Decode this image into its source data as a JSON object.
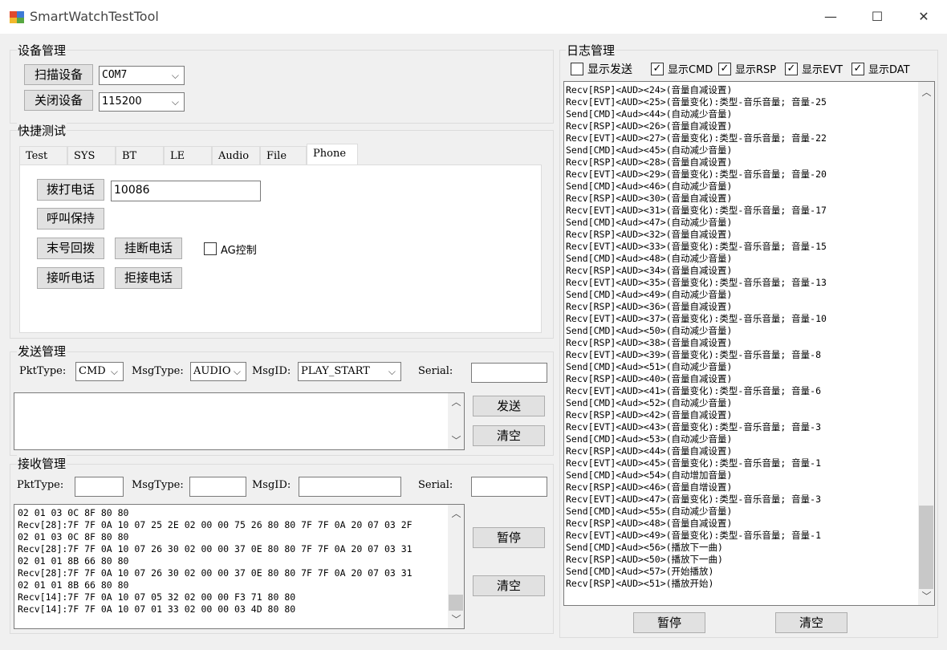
{
  "window": {
    "title": "SmartWatchTestTool",
    "minimize": "—",
    "maximize": "☐",
    "close": "✕"
  },
  "device": {
    "group_label": "设备管理",
    "scan_button": "扫描设备",
    "close_button": "关闭设备",
    "port": "COM7",
    "baud": "115200"
  },
  "quick": {
    "group_label": "快捷测试",
    "tabs": [
      "Test",
      "SYS",
      "BT",
      "LE",
      "Audio",
      "File",
      "Phone"
    ],
    "active_tab": "Phone",
    "dial_button": "拨打电话",
    "dial_number": "10086",
    "hold_button": "呼叫保持",
    "redial_button": "末号回拨",
    "hangup_button": "挂断电话",
    "ag_control_label": "AG控制",
    "answer_button": "接听电话",
    "reject_button": "拒接电话"
  },
  "send": {
    "group_label": "发送管理",
    "pkttype_label": "PktType:",
    "pkttype_value": "CMD",
    "msgtype_label": "MsgType:",
    "msgtype_value": "AUDIO",
    "msgid_label": "MsgID:",
    "msgid_value": "PLAY_START",
    "serial_label": "Serial:",
    "serial_value": "",
    "send_button": "发送",
    "clear_button": "清空"
  },
  "recv": {
    "group_label": "接收管理",
    "pkttype_label": "PktType:",
    "msgtype_label": "MsgType:",
    "msgid_label": "MsgID:",
    "serial_label": "Serial:",
    "pause_button": "暂停",
    "clear_button": "清空",
    "lines": [
      "02 01 03 0C 8F 80 80",
      "Recv[28]:7F 7F 0A 10 07 25 2E 02 00 00 75 26 80 80 7F 7F 0A 20 07 03 2F",
      "02 01 03 0C 8F 80 80",
      "Recv[28]:7F 7F 0A 10 07 26 30 02 00 00 37 0E 80 80 7F 7F 0A 20 07 03 31",
      "02 01 01 8B 66 80 80",
      "Recv[28]:7F 7F 0A 10 07 26 30 02 00 00 37 0E 80 80 7F 7F 0A 20 07 03 31",
      "02 01 01 8B 66 80 80",
      "Recv[14]:7F 7F 0A 10 07 05 32 02 00 00 F3 71 80 80",
      "Recv[14]:7F 7F 0A 10 07 01 33 02 00 00 03 4D 80 80"
    ]
  },
  "log": {
    "group_label": "日志管理",
    "filters": [
      {
        "label": "显示发送",
        "checked": false
      },
      {
        "label": "显示CMD",
        "checked": true
      },
      {
        "label": "显示RSP",
        "checked": true
      },
      {
        "label": "显示EVT",
        "checked": true
      },
      {
        "label": "显示DAT",
        "checked": true
      }
    ],
    "lines": [
      "Recv[RSP]<AUD><24>(音量自减设置)",
      "Recv[EVT]<AUD><25>(音量变化):类型-音乐音量; 音量-25",
      "Send[CMD]<Aud><44>(自动减少音量)",
      "Recv[RSP]<AUD><26>(音量自减设置)",
      "Recv[EVT]<AUD><27>(音量变化):类型-音乐音量; 音量-22",
      "Send[CMD]<Aud><45>(自动减少音量)",
      "Recv[RSP]<AUD><28>(音量自减设置)",
      "Recv[EVT]<AUD><29>(音量变化):类型-音乐音量; 音量-20",
      "Send[CMD]<Aud><46>(自动减少音量)",
      "Recv[RSP]<AUD><30>(音量自减设置)",
      "Recv[EVT]<AUD><31>(音量变化):类型-音乐音量; 音量-17",
      "Send[CMD]<Aud><47>(自动减少音量)",
      "Recv[RSP]<AUD><32>(音量自减设置)",
      "Recv[EVT]<AUD><33>(音量变化):类型-音乐音量; 音量-15",
      "Send[CMD]<Aud><48>(自动减少音量)",
      "Recv[RSP]<AUD><34>(音量自减设置)",
      "Recv[EVT]<AUD><35>(音量变化):类型-音乐音量; 音量-13",
      "Send[CMD]<Aud><49>(自动减少音量)",
      "Recv[RSP]<AUD><36>(音量自减设置)",
      "Recv[EVT]<AUD><37>(音量变化):类型-音乐音量; 音量-10",
      "Send[CMD]<Aud><50>(自动减少音量)",
      "Recv[RSP]<AUD><38>(音量自减设置)",
      "Recv[EVT]<AUD><39>(音量变化):类型-音乐音量; 音量-8",
      "Send[CMD]<Aud><51>(自动减少音量)",
      "Recv[RSP]<AUD><40>(音量自减设置)",
      "Recv[EVT]<AUD><41>(音量变化):类型-音乐音量; 音量-6",
      "Send[CMD]<Aud><52>(自动减少音量)",
      "Recv[RSP]<AUD><42>(音量自减设置)",
      "Recv[EVT]<AUD><43>(音量变化):类型-音乐音量; 音量-3",
      "Send[CMD]<Aud><53>(自动减少音量)",
      "Recv[RSP]<AUD><44>(音量自减设置)",
      "Recv[EVT]<AUD><45>(音量变化):类型-音乐音量; 音量-1",
      "Send[CMD]<Aud><54>(自动增加音量)",
      "Recv[RSP]<AUD><46>(音量自增设置)",
      "Recv[EVT]<AUD><47>(音量变化):类型-音乐音量; 音量-3",
      "Send[CMD]<Aud><55>(自动减少音量)",
      "Recv[RSP]<AUD><48>(音量自减设置)",
      "Recv[EVT]<AUD><49>(音量变化):类型-音乐音量; 音量-1",
      "Send[CMD]<Aud><56>(播放下一曲)",
      "Recv[RSP]<AUD><50>(播放下一曲)",
      "Send[CMD]<Aud><57>(开始播放)",
      "Recv[RSP]<AUD><51>(播放开始)"
    ],
    "pause_button": "暂停",
    "clear_button": "清空"
  }
}
